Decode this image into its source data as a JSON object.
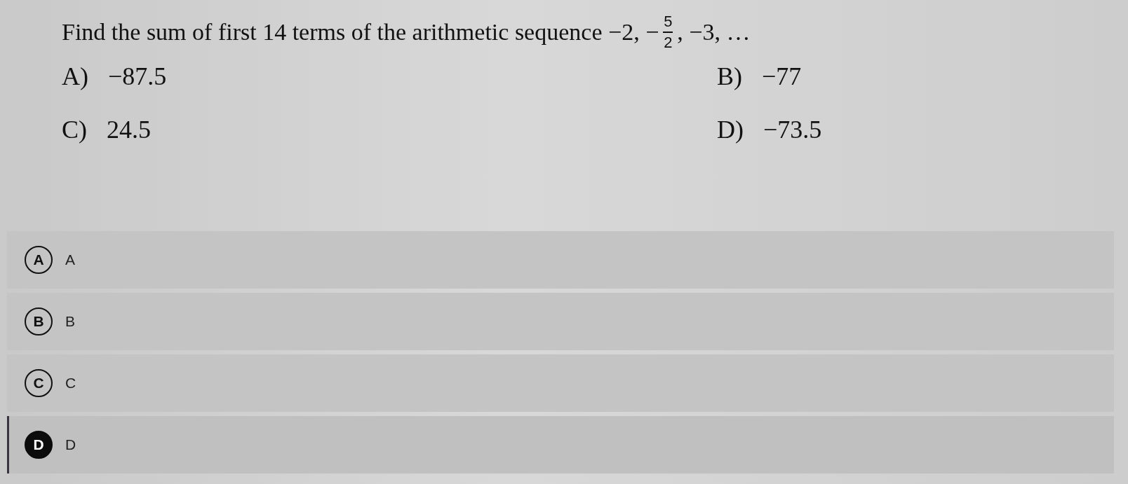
{
  "question": {
    "text_before": "Find the sum of first 14 terms of the arithmetic sequence −2, −",
    "fraction": {
      "numerator": "5",
      "denominator": "2"
    },
    "text_after": ", −3, …"
  },
  "printed_options": [
    {
      "label": "A)",
      "value": "−87.5"
    },
    {
      "label": "B)",
      "value": "−77"
    },
    {
      "label": "C)",
      "value": "24.5"
    },
    {
      "label": "D)",
      "value": "−73.5"
    }
  ],
  "answer_choices": [
    {
      "badge": "A",
      "text": "A",
      "selected": false
    },
    {
      "badge": "B",
      "text": "B",
      "selected": false
    },
    {
      "badge": "C",
      "text": "C",
      "selected": false
    },
    {
      "badge": "D",
      "text": "D",
      "selected": true
    }
  ]
}
